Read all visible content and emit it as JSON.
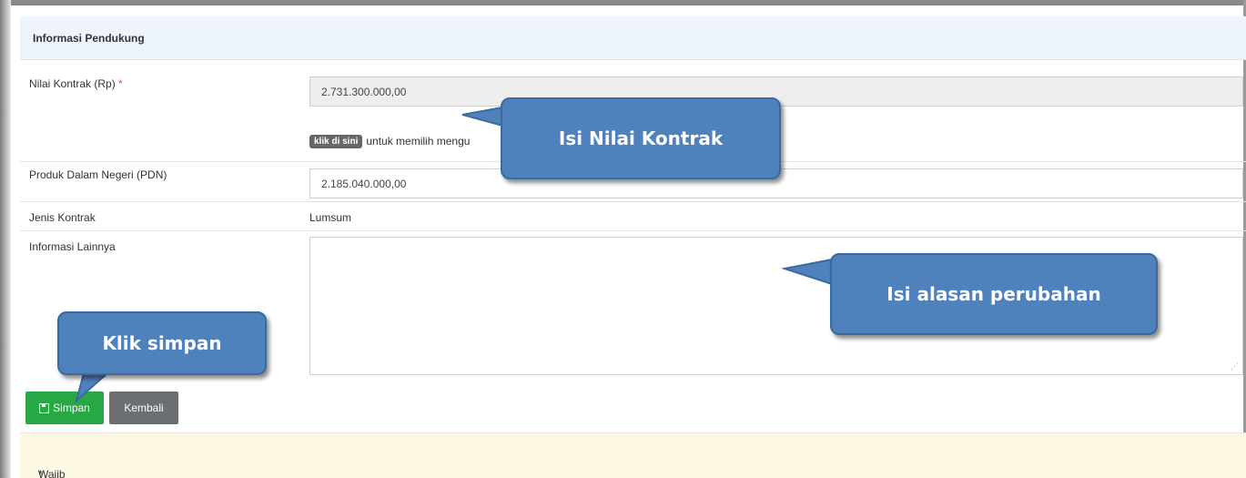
{
  "panel": {
    "heading": "Informasi Pendukung"
  },
  "fields": {
    "nilai_kontrak": {
      "label": "Nilai Kontrak (Rp)",
      "required_mark": "*",
      "value": "2.731.300.000,00"
    },
    "hint": {
      "badge": "klik di sini",
      "text": "untuk memilih mengu"
    },
    "pdn": {
      "label": "Produk Dalam Negeri (PDN)",
      "value": "2.185.040.000,00"
    },
    "jenis_kontrak": {
      "label": "Jenis Kontrak",
      "value": "Lumsum"
    },
    "informasi_lainnya": {
      "label": "Informasi Lainnya",
      "value": ""
    }
  },
  "buttons": {
    "save": "Simpan",
    "back": "Kembali"
  },
  "footer": {
    "required_mark": "*",
    "note": "Wajib Diisi"
  },
  "callouts": {
    "nilai_kontrak": "Isi Nilai Kontrak",
    "alasan": "Isi alasan perubahan",
    "simpan": "Klik simpan"
  },
  "colors": {
    "callout": "#4f81bd",
    "save_button": "#28a745",
    "back_button": "#6b6f74",
    "heading_bg": "#eef4fb",
    "footer_bg": "#fcf8e3"
  }
}
